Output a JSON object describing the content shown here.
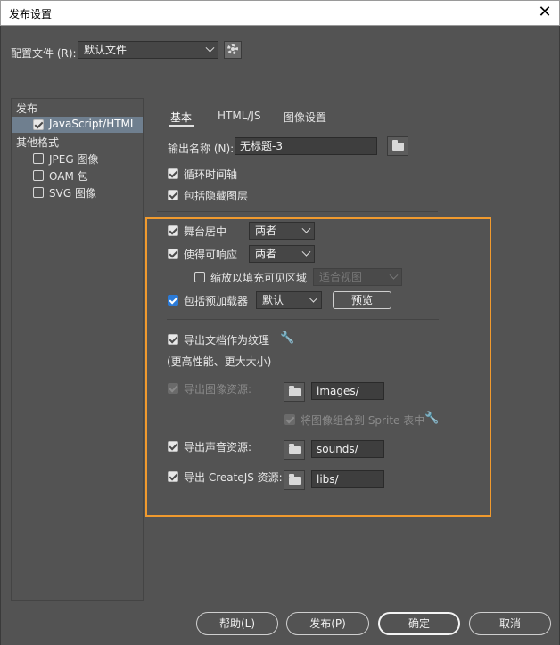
{
  "window": {
    "title": "发布设置",
    "close_icon": "close-icon"
  },
  "profile": {
    "label": "配置文件 (R):",
    "value": "默认文件",
    "gear_icon": "gear-icon"
  },
  "sidebar": {
    "publish_header": "发布",
    "items": [
      {
        "label": "JavaScript/HTML",
        "checked": true,
        "selected": true
      },
      {
        "label": "其他格式",
        "header": true
      },
      {
        "label": "JPEG 图像",
        "checked": false
      },
      {
        "label": "OAM 包",
        "checked": false
      },
      {
        "label": "SVG 图像",
        "checked": false
      }
    ]
  },
  "tabs": [
    {
      "label": "基本",
      "active": true
    },
    {
      "label": "HTML/JS",
      "active": false
    },
    {
      "label": "图像设置",
      "active": false
    }
  ],
  "output": {
    "label": "输出名称 (N):",
    "value": "无标题-3"
  },
  "options": {
    "loop_timeline": "循环时间轴",
    "include_hidden_layers": "包括隐藏图层",
    "center_stage": "舞台居中",
    "center_stage_value": "两者",
    "make_responsive": "使得可响应",
    "make_responsive_value": "两者",
    "scale_to_fill": "缩放以填充可见区域",
    "scale_to_fill_value": "适合视图",
    "include_preloader": "包括预加载器",
    "include_preloader_value": "默认",
    "preview_button": "预览",
    "export_document_as_texture": "导出文档作为纹理",
    "texture_note": "(更高性能、更大大小)",
    "export_image_assets": "导出图像资源:",
    "image_assets_path": "images/",
    "combine_to_sprite": "将图像组合到 Sprite 表中",
    "export_sound_assets": "导出声音资源:",
    "sound_assets_path": "sounds/",
    "export_createjs_assets": "导出 CreateJS 资源:",
    "createjs_assets_path": "libs/"
  },
  "footer": {
    "help": "帮助(L)",
    "publish": "发布(P)",
    "ok": "确定",
    "cancel": "取消"
  },
  "colors": {
    "highlight_box": "#f09a2e",
    "background": "#535353",
    "selected_row": "#6f7f8f"
  }
}
